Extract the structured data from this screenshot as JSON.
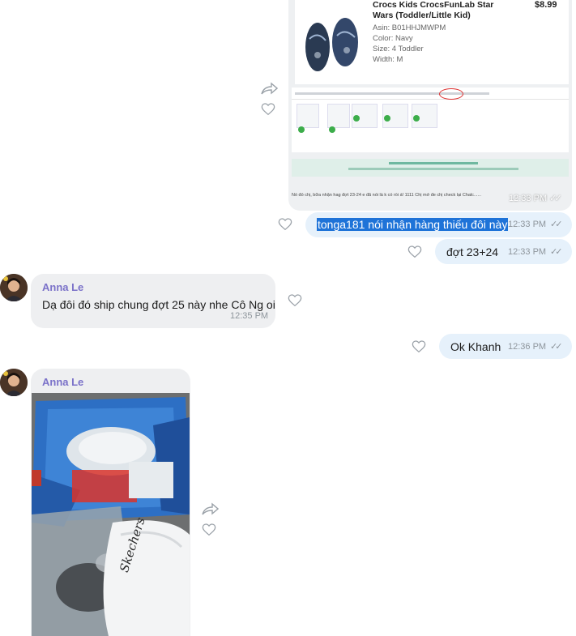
{
  "product_card": {
    "title": "Crocs Kids CrocsFunLab Star Wars (Toddler/Little Kid)",
    "price": "$8.99",
    "asin": "Asin: B01HHJMWPM",
    "color": "Color: Navy",
    "size": "Size: 4 Toddler",
    "width": "Width: M",
    "screenshot_caption": "Nó đó chị, bữa nhận hag đợt 23-24 e đã nói là k có rồi á! 1111 Chị mở đe chị check lại Chalc......",
    "time": "12:33 PM"
  },
  "messages": [
    {
      "id": "m1",
      "text": "tonga181 nói nhận hàng thiếu đôi này",
      "time": "12:33 PM",
      "highlighted": true
    },
    {
      "id": "m2",
      "text": "đợt 23+24",
      "time": "12:33 PM"
    },
    {
      "id": "m3",
      "sender": "Anna Le",
      "text": "Dạ đôi đó ship chung đợt 25 này nhe Cô Ng oi",
      "time": "12:35 PM"
    },
    {
      "id": "m4",
      "text": "Ok Khanh",
      "time": "12:36 PM"
    },
    {
      "id": "m5",
      "sender": "Anna Le"
    }
  ],
  "photo_text": {
    "bag_brand": "Skechers"
  },
  "colors": {
    "outgoing_bubble": "#e6f1fb",
    "incoming_bubble": "#eeeff1",
    "highlight": "#1e73d8",
    "sender": "#7b72c9"
  }
}
